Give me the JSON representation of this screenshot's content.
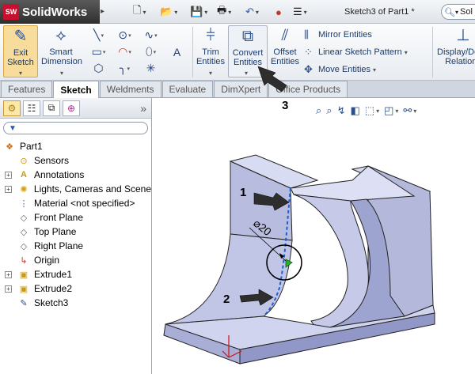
{
  "app": {
    "name": "SolidWorks",
    "logo_mark": "SW",
    "document_title": "Sketch3 of Part1 *"
  },
  "search": {
    "text": "Sol"
  },
  "quick_access": {
    "icons": [
      "new-document-icon",
      "open-folder-icon",
      "save-icon",
      "print-icon",
      "undo-icon",
      "rebuild-icon",
      "options-icon"
    ]
  },
  "command_manager": {
    "exit_sketch": {
      "label": "Exit Sketch"
    },
    "smart_dimension": {
      "label": "Smart Dimension"
    },
    "trim_entities": {
      "label": "Trim Entities"
    },
    "convert_entities": {
      "label": "Convert Entities"
    },
    "offset_entities": {
      "label": "Offset Entities"
    },
    "mirror_entities": {
      "label": "Mirror Entities"
    },
    "linear_sketch_pattern": {
      "label": "Linear Sketch Pattern"
    },
    "move_entities": {
      "label": "Move Entities"
    },
    "display_delete": {
      "label": "Display/Delete Relations"
    }
  },
  "tabs": [
    {
      "label": "Features",
      "active": false
    },
    {
      "label": "Sketch",
      "active": true
    },
    {
      "label": "Weldments",
      "active": false
    },
    {
      "label": "Evaluate",
      "active": false
    },
    {
      "label": "DimXpert",
      "active": false
    },
    {
      "label": "Office Products",
      "active": false
    }
  ],
  "feature_manager": {
    "more": "»",
    "tree": [
      {
        "label": "Part1",
        "expander": "",
        "icon": "part-icon"
      },
      {
        "label": "Sensors",
        "expander": "",
        "icon": "sensor-icon"
      },
      {
        "label": "Annotations",
        "expander": "+",
        "icon": "annotation-icon"
      },
      {
        "label": "Lights, Cameras and Scene",
        "expander": "+",
        "icon": "light-icon"
      },
      {
        "label": "Material <not specified>",
        "expander": "",
        "icon": "material-icon"
      },
      {
        "label": "Front Plane",
        "expander": "",
        "icon": "plane-icon"
      },
      {
        "label": "Top Plane",
        "expander": "",
        "icon": "plane-icon"
      },
      {
        "label": "Right Plane",
        "expander": "",
        "icon": "plane-icon"
      },
      {
        "label": "Origin",
        "expander": "",
        "icon": "origin-icon"
      },
      {
        "label": "Extrude1",
        "expander": "+",
        "icon": "extrude-icon"
      },
      {
        "label": "Extrude2",
        "expander": "+",
        "icon": "extrude-icon"
      },
      {
        "label": "Sketch3",
        "expander": "",
        "icon": "sketch-icon"
      }
    ]
  },
  "viewport": {
    "dimension_label": "⌀20",
    "callouts": [
      "1",
      "2",
      "3"
    ]
  }
}
